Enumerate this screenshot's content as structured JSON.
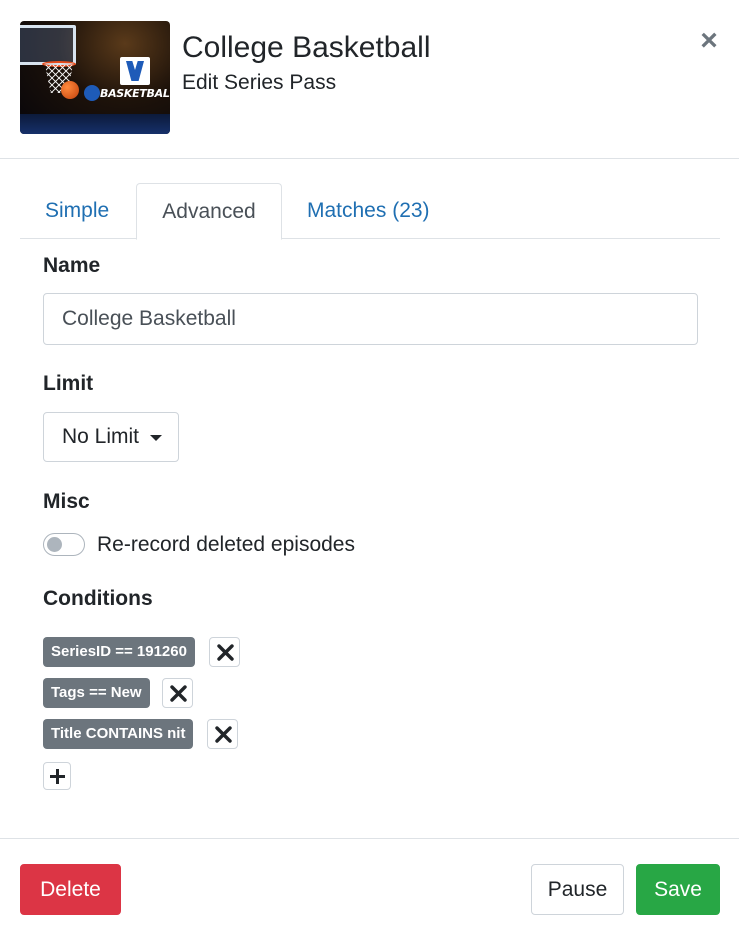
{
  "header": {
    "thumbnail_logo_text": "BASKETBALL",
    "title": "College Basketball",
    "subtitle": "Edit Series Pass",
    "close_symbol": "×"
  },
  "tabs": [
    {
      "label": "Simple",
      "active": false
    },
    {
      "label": "Advanced",
      "active": true
    },
    {
      "label": "Matches (23)",
      "active": false
    }
  ],
  "form": {
    "name_label": "Name",
    "name_value": "College Basketball",
    "limit_label": "Limit",
    "limit_value": "No Limit",
    "misc_label": "Misc",
    "rerecord_label": "Re-record deleted episodes",
    "rerecord_enabled": false,
    "conditions_label": "Conditions",
    "conditions": [
      {
        "text": "SeriesID == 191260"
      },
      {
        "text": "Tags == New"
      },
      {
        "text": "Title CONTAINS nit"
      }
    ]
  },
  "footer": {
    "delete_label": "Delete",
    "pause_label": "Pause",
    "save_label": "Save"
  },
  "colors": {
    "link": "#1f6fb2",
    "badge": "#6c757d",
    "danger": "#dc3545",
    "success": "#28a745"
  },
  "icons": {
    "close": "close-icon",
    "remove_condition": "x-icon",
    "add_condition": "plus-icon",
    "dropdown": "caret-down-icon"
  }
}
